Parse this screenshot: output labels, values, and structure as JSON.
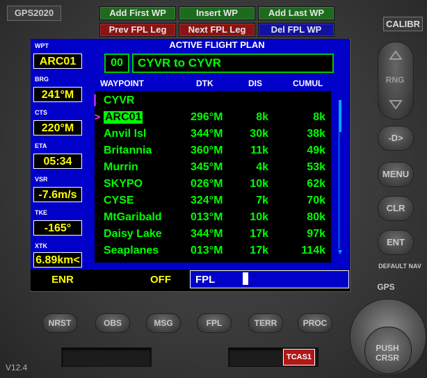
{
  "app_title": "GPS2020",
  "top_buttons": {
    "add_first_wp": "Add First WP",
    "insert_wp": "Insert WP",
    "add_last_wp": "Add Last WP",
    "prev_fpl_leg": "Prev FPL Leg",
    "next_fpl_leg": "Next FPL Leg",
    "del_fpl_wp": "Del FPL WP"
  },
  "calib_label": "CALIBR",
  "side_panel": {
    "wpt_label": "WPT",
    "wpt_value": "ARC01",
    "brg_label": "BRG",
    "brg_value": "241°M",
    "cts_label": "CTS",
    "cts_value": "220°M",
    "eta_label": "ETA",
    "eta_value": "05:34",
    "vsr_label": "VSR",
    "vsr_value": "-7.6m/s",
    "tke_label": "TKE",
    "tke_value": "-165°",
    "xtk_label": "XTK",
    "xtk_value": "6.89km<"
  },
  "flight_plan": {
    "title": "ACTIVE FLIGHT PLAN",
    "number": "00",
    "name": "CYVR to CYVR",
    "headers": {
      "waypoint": "WAYPOINT",
      "dtk": "DTK",
      "dis": "DIS",
      "cumul": "CUMUL"
    },
    "rows": [
      {
        "wp": "CYVR",
        "dtk": "",
        "dis": "",
        "cum": ""
      },
      {
        "wp": "ARC01",
        "dtk": "296°M",
        "dis": "8k",
        "cum": "8k"
      },
      {
        "wp": "Anvil Isl",
        "dtk": "344°M",
        "dis": "30k",
        "cum": "38k"
      },
      {
        "wp": "Britannia",
        "dtk": "360°M",
        "dis": "11k",
        "cum": "49k"
      },
      {
        "wp": "Murrin",
        "dtk": "345°M",
        "dis": "4k",
        "cum": "53k"
      },
      {
        "wp": "SKYPO",
        "dtk": "026°M",
        "dis": "10k",
        "cum": "62k"
      },
      {
        "wp": "CYSE",
        "dtk": "324°M",
        "dis": "7k",
        "cum": "70k"
      },
      {
        "wp": "MtGaribald",
        "dtk": "013°M",
        "dis": "10k",
        "cum": "80k"
      },
      {
        "wp": "Daisy Lake",
        "dtk": "344°M",
        "dis": "17k",
        "cum": "97k"
      },
      {
        "wp": "Seaplanes",
        "dtk": "013°M",
        "dis": "17k",
        "cum": "114k"
      }
    ]
  },
  "status_bar": {
    "mode": "ENR",
    "off": "OFF",
    "page": "FPL"
  },
  "right_buttons": {
    "rng": "RNG",
    "direct": "-D>",
    "menu": "MENU",
    "clr": "CLR",
    "ent": "ENT",
    "default_nav": "DEFAULT NAV",
    "gps": "GPS",
    "push_crsr": "PUSH CRSR"
  },
  "bottom_buttons": {
    "nrst": "NRST",
    "obs": "OBS",
    "msg": "MSG",
    "fpl": "FPL",
    "terr": "TERR",
    "proc": "PROC"
  },
  "tcas_label": "TCAS1",
  "version": "V12.4",
  "colors": {
    "screen_blue": "#0000c8",
    "text_green": "#00ff00",
    "text_yellow": "#ffff00",
    "cursor_magenta": "#ff40ff"
  }
}
